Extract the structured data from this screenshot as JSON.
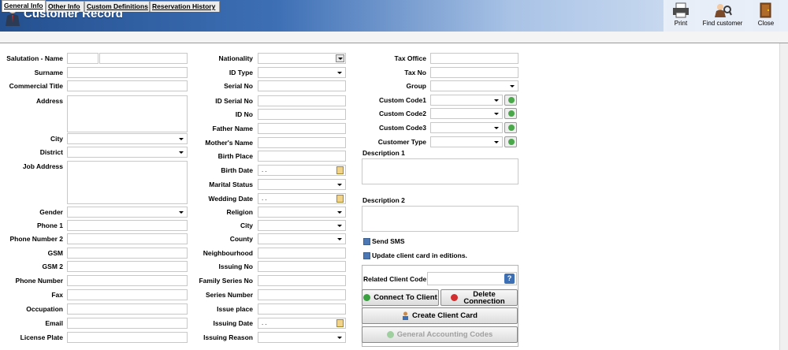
{
  "window": {
    "title": "Customer Record",
    "toolbar": {
      "print": "Print",
      "find": "Find customer",
      "close": "Close"
    }
  },
  "tabs": [
    "General Info",
    "Other Info",
    "Custom Definitions",
    "Reservation History"
  ],
  "col1": {
    "salutation_name": "Salutation - Name",
    "surname": "Surname",
    "commercial_title": "Commercial Title",
    "address": "Address",
    "city": "City",
    "district": "District",
    "job_address": "Job Address",
    "gender": "Gender",
    "phone1": "Phone 1",
    "phone2": "Phone Number 2",
    "gsm": "GSM",
    "gsm2": "GSM 2",
    "phone_number": "Phone Number",
    "fax": "Fax",
    "occupation": "Occupation",
    "email": "Email",
    "license_plate": "License Plate"
  },
  "col2": {
    "nationality": "Nationality",
    "id_type": "ID Type",
    "serial_no": "Serial No",
    "id_serial_no": "ID Serial No",
    "id_no": "ID No",
    "father_name": "Father Name",
    "mother_name": "Mother's Name",
    "birth_place": "Birth Place",
    "birth_date": "Birth Date",
    "marital_status": "Marital Status",
    "wedding_date": "Wedding Date",
    "religion": "Religion",
    "city": "City",
    "county": "County",
    "neighbourhood": "Neighbourhood",
    "issuing_no": "Issuing No",
    "family_series_no": "Family Series No",
    "series_number": "Series Number",
    "issue_place": "Issue place",
    "issuing_date": "Issuing Date",
    "issuing_reason": "Issuing Reason",
    "date_placeholder": ". ."
  },
  "col3": {
    "tax_office": "Tax Office",
    "tax_no": "Tax No",
    "group": "Group",
    "custom_code1": "Custom Code1",
    "custom_code2": "Custom Code2",
    "custom_code3": "Custom Code3",
    "customer_type": "Customer Type",
    "description1": "Description 1",
    "description2": "Description 2",
    "send_sms": "Send SMS",
    "update_client_card": "Update client card in editions.",
    "related_client_code": "Related Client Code",
    "connect_to_client": "Connect To Client",
    "delete_connection": "Delete Connection",
    "create_client_card": "Create Client Card",
    "general_accounting_codes": "General Accounting Codes"
  }
}
